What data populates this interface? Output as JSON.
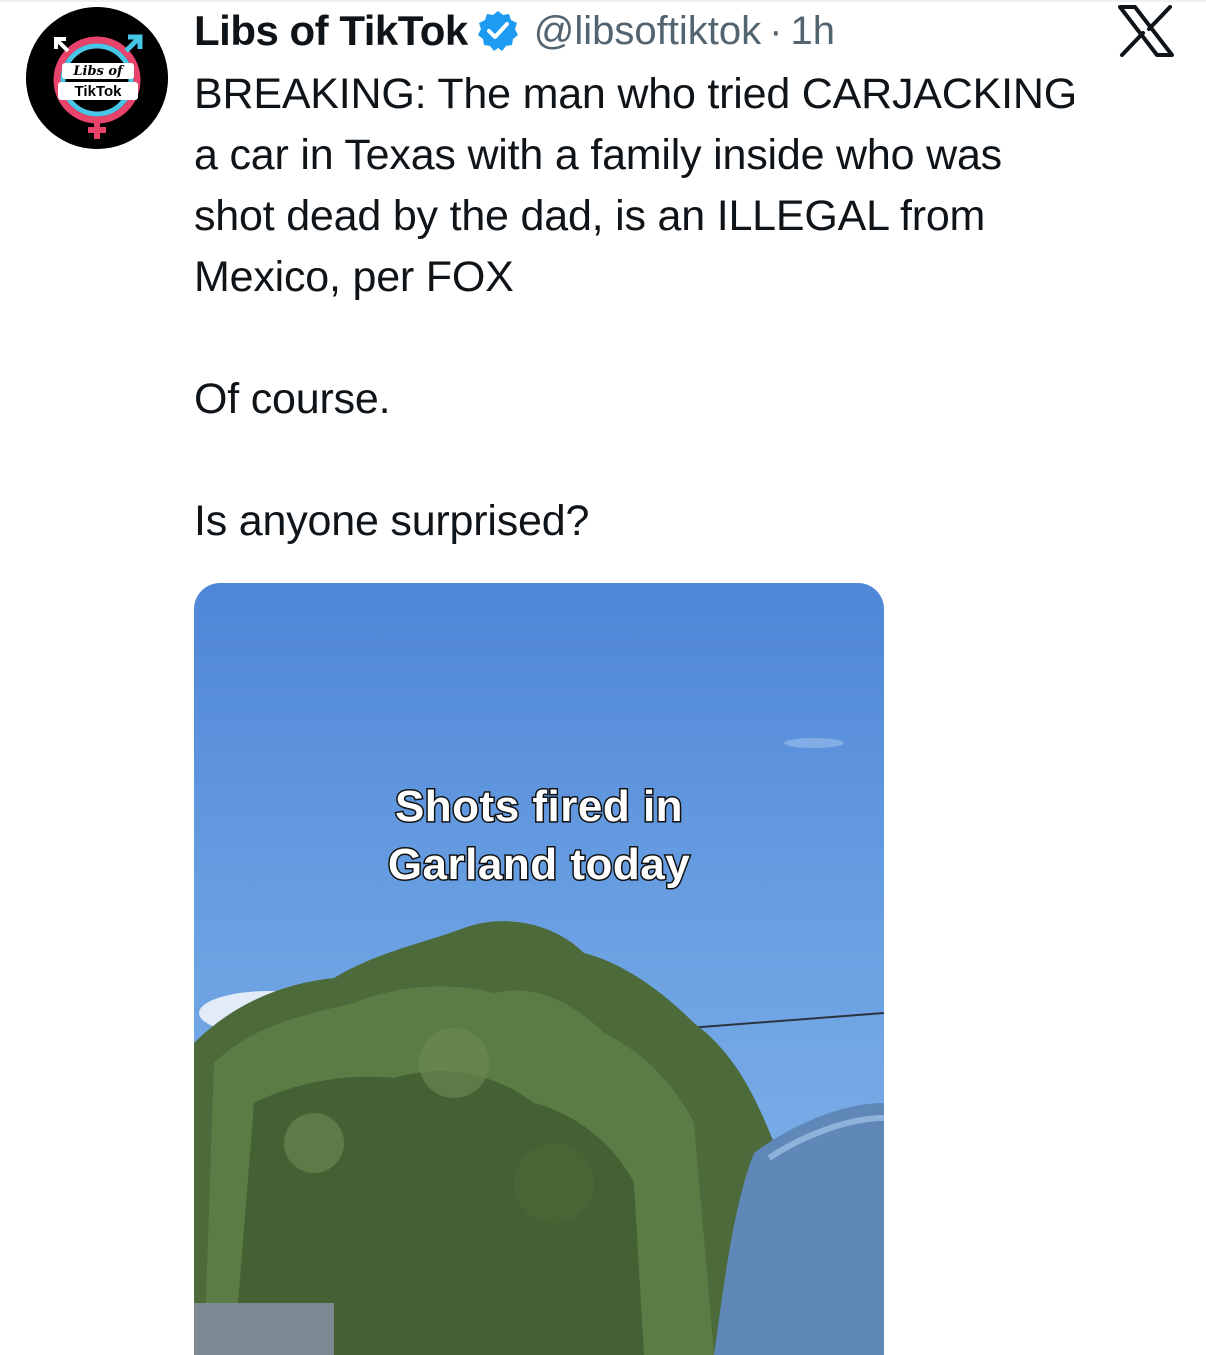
{
  "tweet": {
    "avatar_text_line1": "Libs of",
    "avatar_text_line2": "TikTok",
    "display_name": "Libs of TikTok",
    "handle": "@libsoftiktok",
    "separator": "·",
    "time": "1h",
    "text": "BREAKING: The man who tried CARJACKING\na car in Texas with a family inside who was\nshot dead by the dad, is an ILLEGAL from\nMexico, per FOX\n\nOf course.\n\nIs anyone surprised?",
    "media": {
      "caption_line1": "Shots fired in",
      "caption_line2": "Garland today"
    }
  },
  "icons": {
    "verified": "verified-badge-icon",
    "platform": "x-logo-icon"
  },
  "colors": {
    "verified_blue": "#1d9bf0",
    "secondary_text": "#536471",
    "avatar_pink": "#e8436a",
    "avatar_cyan": "#48c6e6"
  }
}
